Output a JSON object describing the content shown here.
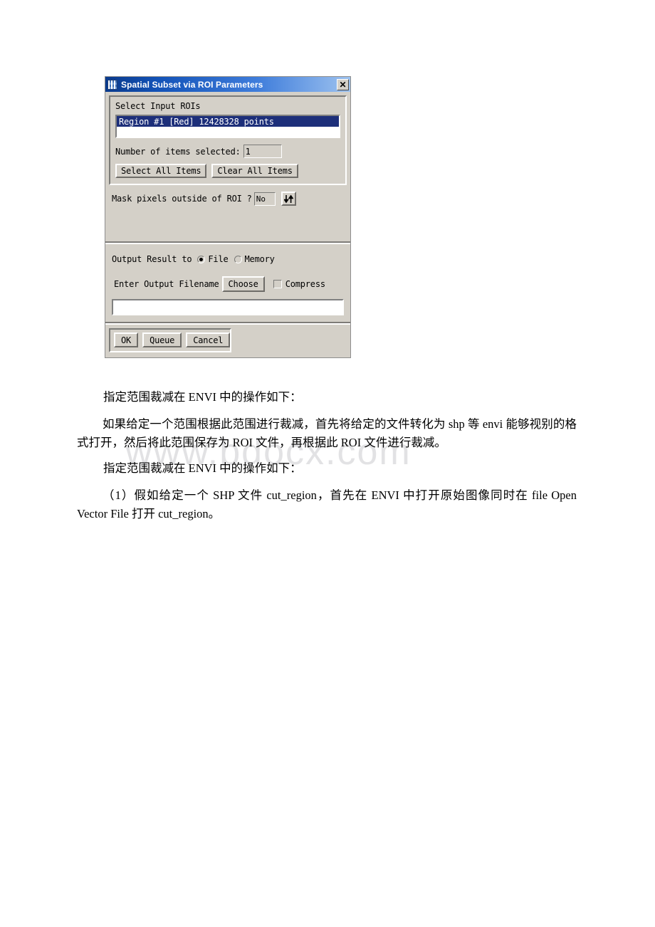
{
  "dialog": {
    "title": "Spatial Subset via ROI Parameters",
    "title_icon": "app-window-icon",
    "close_label": "✕",
    "roi_group": {
      "label": "Select Input ROIs",
      "list_items": [
        "Region #1 [Red] 12428328 points"
      ],
      "count_label": "Number of items selected:",
      "count_value": "1",
      "select_all_label": "Select All Items",
      "clear_all_label": "Clear All Items"
    },
    "mask": {
      "label": "Mask pixels outside of ROI ?",
      "value": "No",
      "toggle_icon": "up-down-arrows-icon"
    },
    "output": {
      "result_label": "Output Result to",
      "file_label": "File",
      "memory_label": "Memory",
      "selected": "File",
      "filename_label": "Enter Output Filename",
      "choose_label": "Choose",
      "compress_label": "Compress",
      "compress_checked": false,
      "filename_value": "",
      "filename_placeholder": ""
    },
    "actions": {
      "ok_label": "OK",
      "queue_label": "Queue",
      "cancel_label": "Cancel"
    },
    "colors": {
      "titlebar_start": "#0a3a8c",
      "titlebar_end": "#9dc2ef",
      "face": "#d4d0c8",
      "selection": "#1d2f7a"
    }
  },
  "watermark": {
    "text": "www.bdocx.com"
  },
  "document": {
    "paragraphs": [
      "指定范围裁减在 ENVI 中的操作如下：",
      "如果给定一个范围根据此范围进行裁减，首先将给定的文件转化为 shp 等 envi 能够视别的格式打开，然后将此范围保存为 ROI 文件，再根据此 ROI 文件进行裁减。",
      "指定范围裁减在 ENVI 中的操作如下：",
      "（1）假如给定一个 SHP 文件 cut_region，首先在 ENVI 中打开原始图像同时在 file Open Vector File 打开 cut_region。"
    ]
  }
}
